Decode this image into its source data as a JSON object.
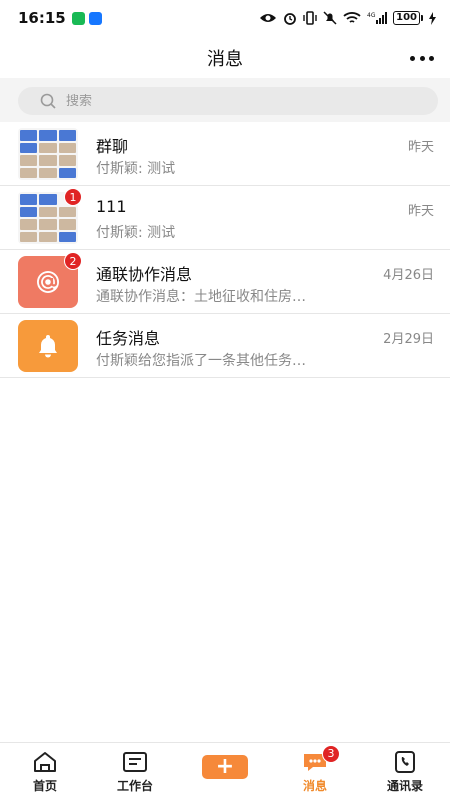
{
  "status_bar": {
    "time": "16:15",
    "battery": "100",
    "icons": [
      "wechat-icon",
      "alipay-icon",
      "eye-icon",
      "alarm-icon",
      "vibrate-icon",
      "mute-icon",
      "wifi-icon",
      "signal-4g-icon",
      "battery-icon",
      "charging-icon"
    ]
  },
  "header": {
    "title": "消息"
  },
  "search": {
    "placeholder": "搜索"
  },
  "conversations": [
    {
      "name": "群聊",
      "preview": "付斯颖: 测试",
      "time": "昨天",
      "avatar": "group-avatar",
      "badge": ""
    },
    {
      "name": "111",
      "preview": "付斯颖: 测试",
      "time": "昨天",
      "avatar": "group-avatar",
      "badge": "1"
    },
    {
      "name": "通联协作消息",
      "preview": "通联协作消息：土地征收和住房…",
      "time": "4月26日",
      "avatar": "at-sign-icon",
      "avatar_color": "#ef7a63",
      "badge": "2"
    },
    {
      "name": "任务消息",
      "preview": "付斯颖给您指派了一条其他任务…",
      "time": "2月29日",
      "avatar": "bell-icon",
      "avatar_color": "#f79a3b",
      "badge": ""
    }
  ],
  "bottom_nav": {
    "items": [
      {
        "label": "首页",
        "icon": "home-icon"
      },
      {
        "label": "工作台",
        "icon": "workbench-icon"
      },
      {
        "label": "",
        "icon": "plus-icon",
        "text": "+"
      },
      {
        "label": "消息",
        "icon": "message-icon",
        "badge": "3",
        "active": true
      },
      {
        "label": "通讯录",
        "icon": "contacts-icon"
      }
    ]
  },
  "colors": {
    "accent": "#f6893a",
    "badge": "#e02424",
    "at_avatar": "#ef7a63",
    "bell_avatar": "#f79a3b"
  }
}
